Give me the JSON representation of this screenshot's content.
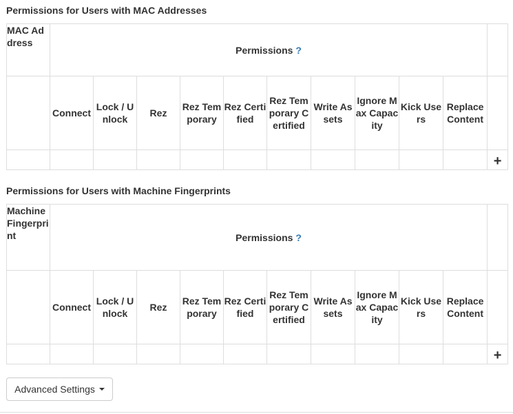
{
  "mac_section": {
    "title": "Permissions for Users with MAC Addresses",
    "id_header": "MAC Address",
    "permissions_header": "Permissions",
    "help": "?"
  },
  "fp_section": {
    "title": "Permissions for Users with Machine Fingerprints",
    "id_header": "Machine Fingerprint",
    "permissions_header": "Permissions",
    "help": "?"
  },
  "columns": [
    "Connect",
    "Lock / Unlock",
    "Rez",
    "Rez Temporary",
    "Rez Certified",
    "Rez Temporary Certified",
    "Write Assets",
    "Ignore Max Capacity",
    "Kick Users",
    "Replace Content"
  ],
  "add_label": "+",
  "advanced_settings_label": "Advanced Settings"
}
